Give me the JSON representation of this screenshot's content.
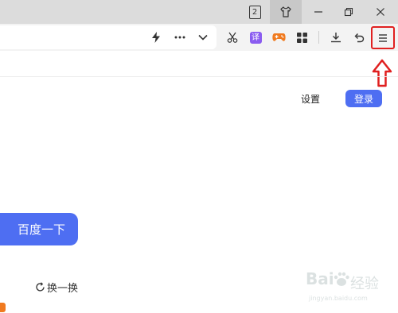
{
  "titlebar": {
    "tab_count": "2",
    "skin_icon": "tshirt-icon",
    "minimize_icon": "minimize-icon",
    "restore_icon": "restore-icon",
    "close_icon": "close-icon"
  },
  "toolbar": {
    "icons": [
      "lightning-icon",
      "more-dots-icon",
      "chevron-down-icon",
      "scissors-icon",
      "translate-icon",
      "gamepad-icon",
      "apps-grid-icon",
      "download-icon",
      "undo-icon",
      "menu-icon"
    ],
    "translate_label": "译"
  },
  "page": {
    "settings": "设置",
    "login": "登录",
    "search_button": "百度一下",
    "refresh": "换一换"
  },
  "watermark": {
    "brand": "Bai",
    "brand_cn": "经验",
    "sub": "jingyan.baidu.com"
  },
  "colors": {
    "accent": "#4e6ef2",
    "highlight": "#e02020",
    "titlebar": "#dcdcdc"
  }
}
